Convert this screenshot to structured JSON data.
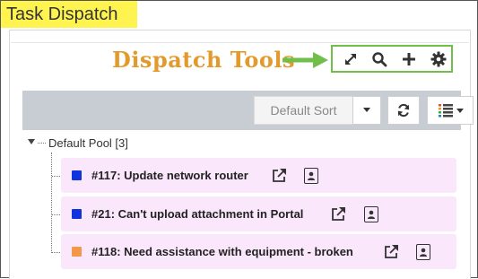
{
  "app": {
    "title": "Task Dispatch"
  },
  "callout": {
    "label": "Dispatch Tools",
    "color": "#e39a2d",
    "box_color": "#6fbf4a"
  },
  "tools": [
    {
      "icon": "expand-icon"
    },
    {
      "icon": "search-icon"
    },
    {
      "icon": "plus-icon"
    },
    {
      "icon": "gear-icon"
    }
  ],
  "toolbar": {
    "sort_label": "Default Sort",
    "sort_caret_icon": "caret-down-icon",
    "refresh_icon": "refresh-icon",
    "view_icon": "list-view-icon"
  },
  "pool": {
    "label": "Default Pool [3]"
  },
  "tickets": [
    {
      "title": "#117: Update network router",
      "color": "#1133dd",
      "background": "#fbe7fb"
    },
    {
      "title": "#21: Can't upload attachment in Portal",
      "color": "#1133dd",
      "background": "#fbe7fb"
    },
    {
      "title": "#118: Need assistance with equipment - broken",
      "color": "#f4974a",
      "background": "#fbe7fb"
    }
  ]
}
